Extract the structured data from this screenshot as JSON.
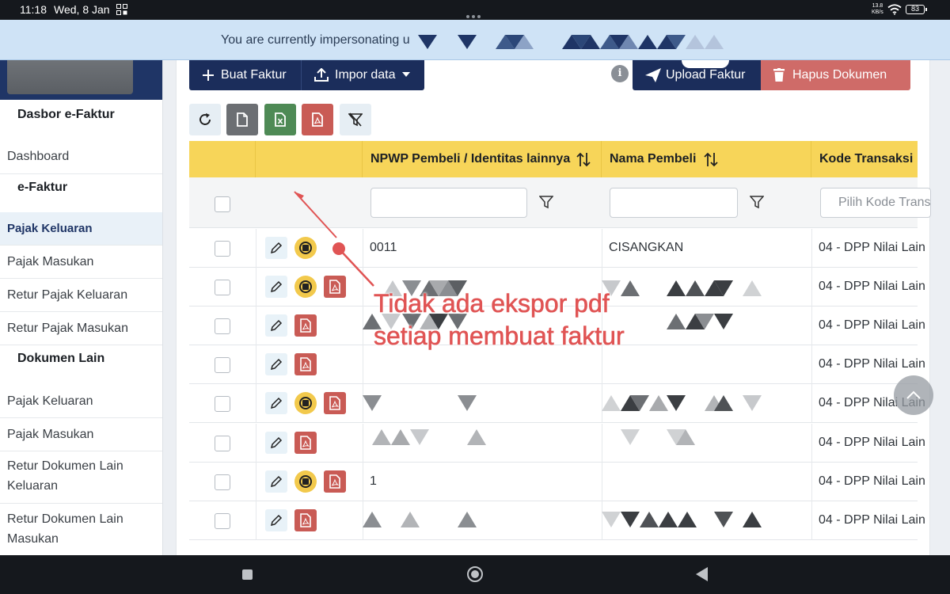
{
  "status_bar": {
    "time": "11:18",
    "date": "Wed, 8 Jan",
    "net_speed": "13.8",
    "net_unit": "KB/s",
    "battery": "83"
  },
  "banner": {
    "message": "You are currently impersonating u"
  },
  "sidebar": {
    "sections": [
      {
        "title": "Dasbor e-Faktur"
      },
      {
        "item": "Dashboard"
      },
      {
        "title": "e-Faktur"
      },
      {
        "item": "Pajak Keluaran",
        "active": true
      },
      {
        "item": "Pajak Masukan"
      },
      {
        "item": "Retur Pajak Keluaran"
      },
      {
        "item": "Retur Pajak Masukan"
      },
      {
        "title": "Dokumen Lain"
      },
      {
        "item": "Pajak Keluaran"
      },
      {
        "item": "Pajak Masukan"
      },
      {
        "item": "Retur Dokumen Lain Keluaran"
      },
      {
        "item": "Retur Dokumen Lain Masukan"
      }
    ]
  },
  "toolbar": {
    "create_label": "Buat Faktur",
    "import_label": "Impor data",
    "upload_label": "Upload Faktur",
    "delete_label": "Hapus Dokumen"
  },
  "table": {
    "columns": [
      "NPWP Pembeli / Identitas lainnya",
      "Nama Pembeli",
      "Kode Transaksi"
    ],
    "filter_placeholder_code": "Pilih Kode Transaksi",
    "rows": [
      {
        "npwp": "0011",
        "name": "CISANGKAN",
        "code": "04 - DPP Nilai Lain",
        "stop": true,
        "pdf": false
      },
      {
        "npwp": "",
        "name": "",
        "code": "04 - DPP Nilai Lain",
        "stop": true,
        "pdf": true
      },
      {
        "npwp": "",
        "name": "",
        "code": "04 - DPP Nilai Lain",
        "stop": false,
        "pdf": true
      },
      {
        "npwp": "",
        "name": "",
        "code": "04 - DPP Nilai Lain",
        "stop": false,
        "pdf": true
      },
      {
        "npwp": "",
        "name": "",
        "code": "04 - DPP Nilai Lain",
        "stop": true,
        "pdf": true
      },
      {
        "npwp": "",
        "name": "",
        "code": "04 - DPP Nilai Lain",
        "stop": false,
        "pdf": true
      },
      {
        "npwp": "1",
        "name": "",
        "code": "04 - DPP Nilai Lain",
        "stop": true,
        "pdf": true
      },
      {
        "npwp": "",
        "name": "",
        "code": "04 - DPP Nilai Lain",
        "stop": false,
        "pdf": true
      }
    ]
  },
  "annotation": {
    "line1": "Tidak ada ekspor pdf",
    "line2": "setiap membuat faktur"
  },
  "colors": {
    "header_yellow": "#f7d559",
    "navy": "#1b2d5b",
    "danger": "#cf6b68",
    "annotation": "#e05454"
  }
}
